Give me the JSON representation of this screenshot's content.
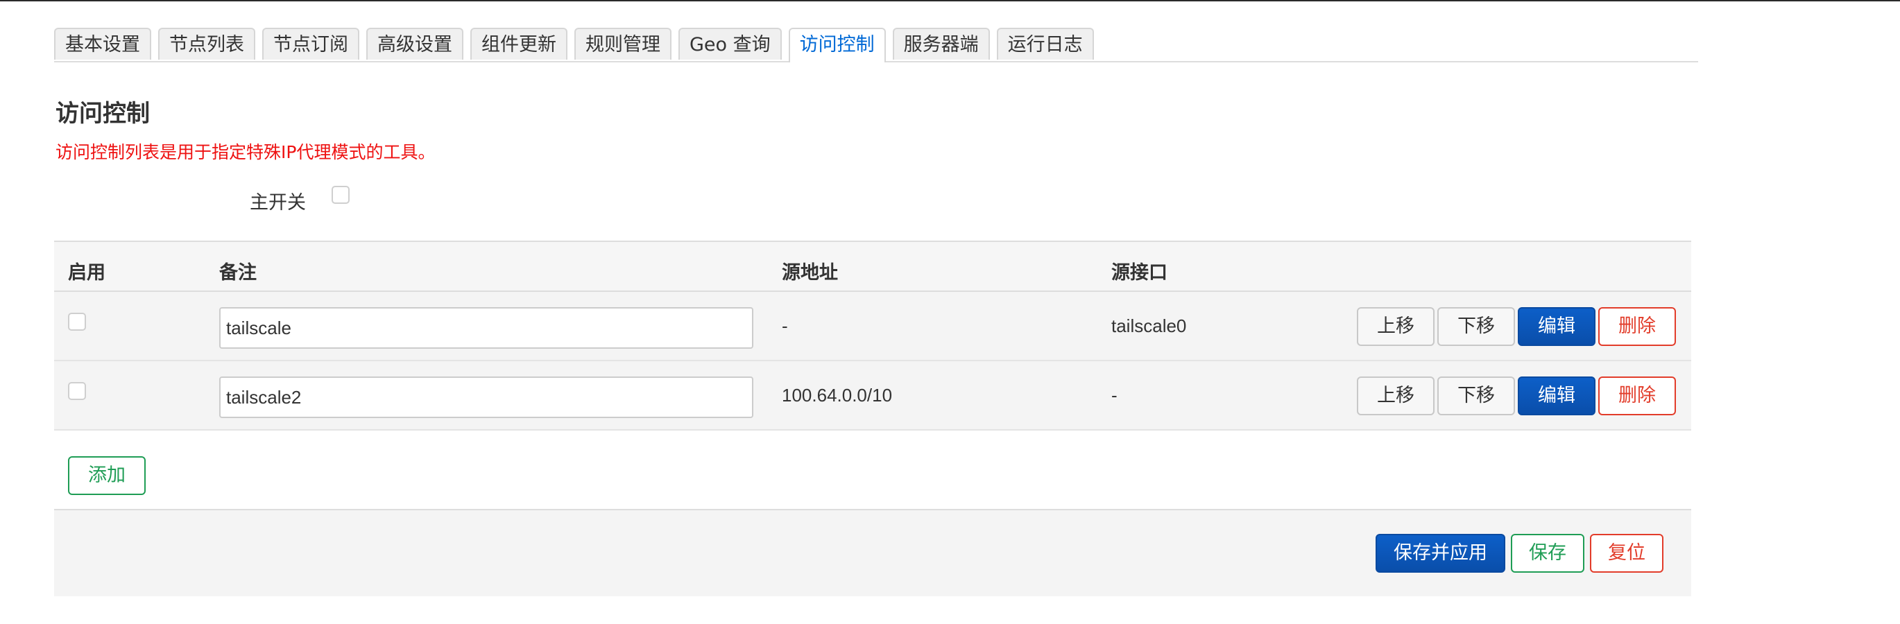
{
  "tabs": [
    {
      "label": "基本设置",
      "active": false
    },
    {
      "label": "节点列表",
      "active": false
    },
    {
      "label": "节点订阅",
      "active": false
    },
    {
      "label": "高级设置",
      "active": false
    },
    {
      "label": "组件更新",
      "active": false
    },
    {
      "label": "规则管理",
      "active": false
    },
    {
      "label": "Geo 查询",
      "active": false
    },
    {
      "label": "访问控制",
      "active": true
    },
    {
      "label": "服务器端",
      "active": false
    },
    {
      "label": "运行日志",
      "active": false
    }
  ],
  "section": {
    "title": "访问控制",
    "description": "访问控制列表是用于指定特殊IP代理模式的工具。"
  },
  "main_switch": {
    "label": "主开关",
    "checked": false
  },
  "table": {
    "headers": {
      "enable": "启用",
      "remark": "备注",
      "source_address": "源地址",
      "source_interface": "源接口"
    },
    "rows": [
      {
        "enabled": false,
        "remark": "tailscale",
        "source_address": "-",
        "source_interface": "tailscale0"
      },
      {
        "enabled": false,
        "remark": "tailscale2",
        "source_address": "100.64.0.0/10",
        "source_interface": "-"
      }
    ],
    "row_actions": {
      "up": "上移",
      "down": "下移",
      "edit": "编辑",
      "delete": "删除"
    },
    "add_label": "添加"
  },
  "footer": {
    "save_apply": "保存并应用",
    "save": "保存",
    "reset": "复位"
  },
  "colors": {
    "accent": "#0a4eaa",
    "active_tab": "#0069d6",
    "danger": "#e23c2a",
    "success": "#1f9d55",
    "description": "#ee1111"
  }
}
